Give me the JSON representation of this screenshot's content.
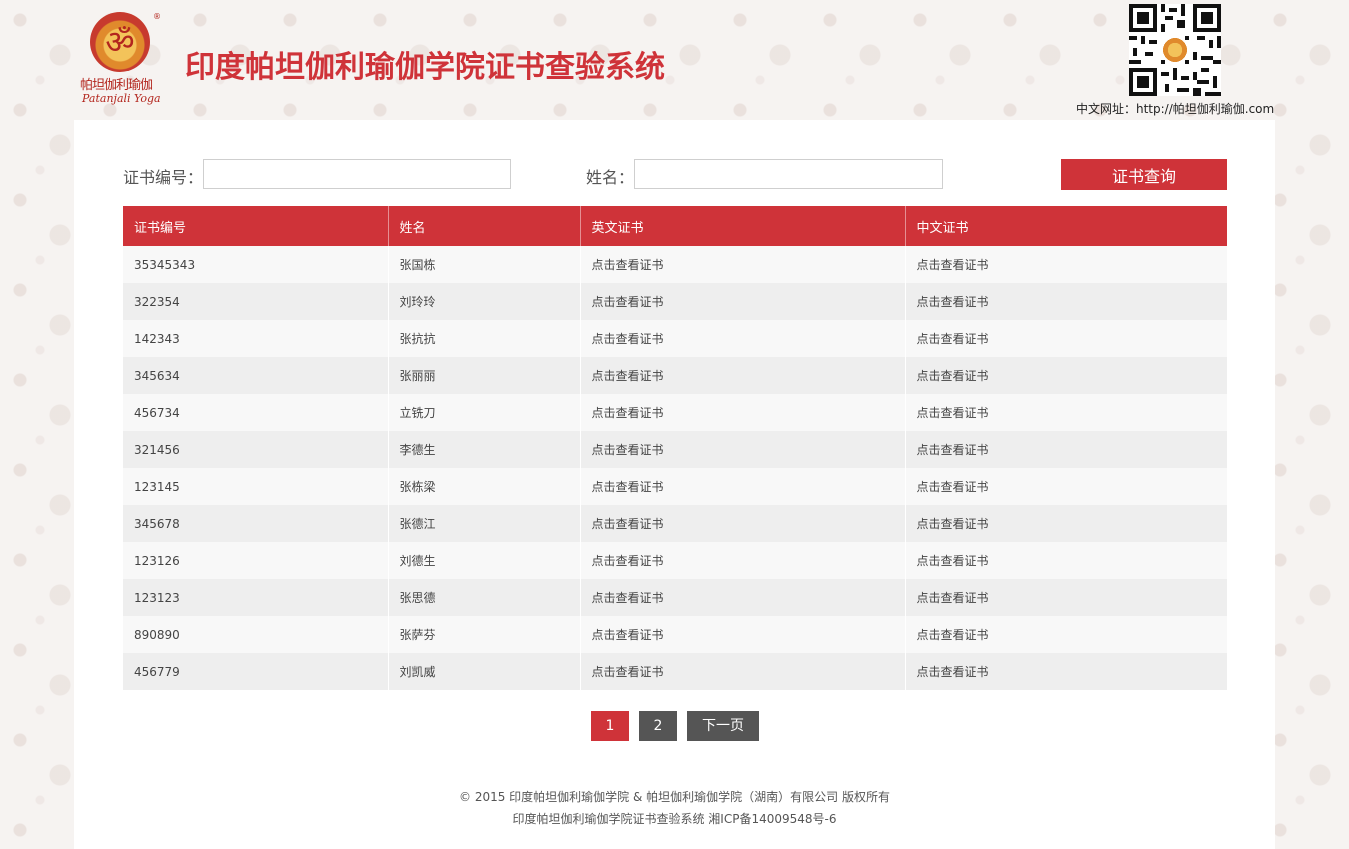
{
  "header": {
    "logo": {
      "cn_text": "帕坦伽利瑜伽",
      "en_text": "Patanjali Yoga",
      "tm": "®"
    },
    "title": "印度帕坦伽利瑜伽学院证书查验系统",
    "url_label": "中文网址：http://帕坦伽利瑜伽.com"
  },
  "search": {
    "cert_no_label": "证书编号：",
    "cert_no_value": "",
    "name_label": "姓名：",
    "name_value": "",
    "button_label": "证书查询"
  },
  "table": {
    "columns": [
      "证书编号",
      "姓名",
      "英文证书",
      "中文证书"
    ],
    "rows": [
      {
        "cert_no": "35345343",
        "name": "张国栋",
        "en_cert": "点击查看证书",
        "cn_cert": "点击查看证书"
      },
      {
        "cert_no": "322354",
        "name": "刘玲玲",
        "en_cert": "点击查看证书",
        "cn_cert": "点击查看证书"
      },
      {
        "cert_no": "142343",
        "name": "张抗抗",
        "en_cert": "点击查看证书",
        "cn_cert": "点击查看证书"
      },
      {
        "cert_no": "345634",
        "name": "张丽丽",
        "en_cert": "点击查看证书",
        "cn_cert": "点击查看证书"
      },
      {
        "cert_no": "456734",
        "name": "立铣刀",
        "en_cert": "点击查看证书",
        "cn_cert": "点击查看证书"
      },
      {
        "cert_no": "321456",
        "name": "李德生",
        "en_cert": "点击查看证书",
        "cn_cert": "点击查看证书"
      },
      {
        "cert_no": "123145",
        "name": "张栋梁",
        "en_cert": "点击查看证书",
        "cn_cert": "点击查看证书"
      },
      {
        "cert_no": "345678",
        "name": "张德江",
        "en_cert": "点击查看证书",
        "cn_cert": "点击查看证书"
      },
      {
        "cert_no": "123126",
        "name": "刘德生",
        "en_cert": "点击查看证书",
        "cn_cert": "点击查看证书"
      },
      {
        "cert_no": "123123",
        "name": "张思德",
        "en_cert": "点击查看证书",
        "cn_cert": "点击查看证书"
      },
      {
        "cert_no": "890890",
        "name": "张萨芬",
        "en_cert": "点击查看证书",
        "cn_cert": "点击查看证书"
      },
      {
        "cert_no": "456779",
        "name": "刘凯威",
        "en_cert": "点击查看证书",
        "cn_cert": "点击查看证书"
      }
    ]
  },
  "pagination": {
    "pages": [
      "1",
      "2"
    ],
    "current": "1",
    "next_label": "下一页"
  },
  "footer": {
    "copyright": "© 2015 印度帕坦伽利瑜伽学院 & 帕坦伽利瑜伽学院（湖南）有限公司 版权所有",
    "icp": "印度帕坦伽利瑜伽学院证书查验系统 湘ICP备14009548号-6"
  },
  "colors": {
    "accent": "#cf3339",
    "pager_inactive": "#555555",
    "row_odd": "#f8f8f8",
    "row_even": "#eeeeee"
  }
}
